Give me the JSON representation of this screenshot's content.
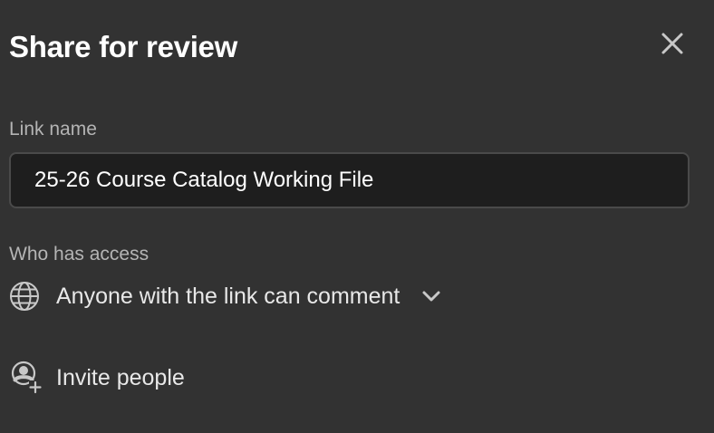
{
  "dialog": {
    "title": "Share for review",
    "close_icon": "close-icon"
  },
  "link_name": {
    "label": "Link name",
    "value": "25-26 Course Catalog Working File"
  },
  "access": {
    "label": "Who has access",
    "icon": "globe-icon",
    "selected": "Anyone with the link can comment",
    "dropdown_icon": "chevron-down-icon"
  },
  "invite": {
    "icon": "add-person-icon",
    "label": "Invite people"
  },
  "colors": {
    "background": "#323232",
    "input_background": "#1e1e1e",
    "input_border": "#4a4a4a",
    "label": "#b4b4b4",
    "text": "#e8e8e8"
  }
}
